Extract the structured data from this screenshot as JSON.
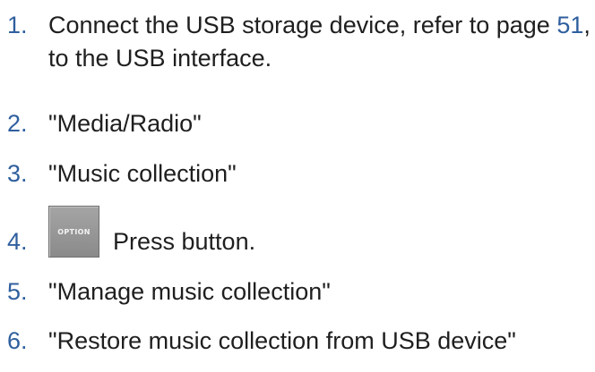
{
  "accent_color": "#2f5f9e",
  "steps": [
    {
      "number": "1.",
      "text_before": "Connect the USB storage device, refer to page ",
      "page_ref": "51",
      "text_after": ", to the USB interface."
    },
    {
      "number": "2.",
      "text": "\"Media/Radio\""
    },
    {
      "number": "3.",
      "text": "\"Music collection\""
    },
    {
      "number": "4.",
      "button_label": "OPTION",
      "text": "Press button."
    },
    {
      "number": "5.",
      "text": "\"Manage music collection\""
    },
    {
      "number": "6.",
      "text": "\"Restore music collection from USB device\""
    }
  ]
}
